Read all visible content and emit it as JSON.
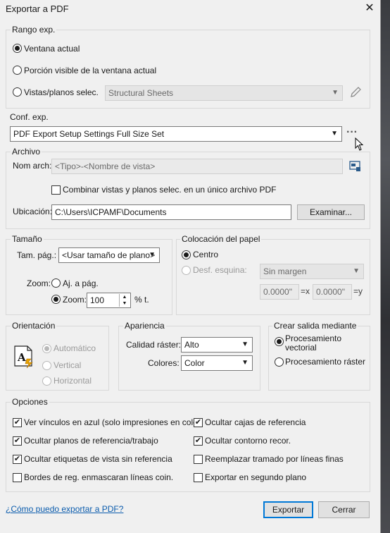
{
  "dialog": {
    "title": "Exportar a PDF",
    "close_label": "✕"
  },
  "rango": {
    "label": "Rango exp.",
    "current_window": "Ventana actual",
    "visible_portion": "Porción visible de la ventana actual",
    "views_sheets": "Vistas/planos selec.",
    "views_sheets_combo": "Structural Sheets",
    "selected": "current_window"
  },
  "conf": {
    "label": "Conf. exp.",
    "setup_combo": "PDF Export Setup Settings Full Size Set",
    "more_label": "···"
  },
  "archivo": {
    "label": "Archivo",
    "name_label": "Nom arch:",
    "name_value": "<Tipo>-<Nombre de vista>",
    "combine_label": "Combinar vistas y planos selec. en un único archivo PDF",
    "location_label": "Ubicación:",
    "location_value": "C:\\Users\\ICPAMF\\Documents",
    "browse_label": "Examinar..."
  },
  "tamano": {
    "label": "Tamaño",
    "page_label": "Tam. pág.:",
    "page_combo": "<Usar tamaño de plano>",
    "zoom_label": "Zoom:",
    "fit_label": "Aj. a pág.",
    "zoom_radio_label": "Zoom:",
    "zoom_value": "100",
    "zoom_unit": "% t.",
    "selected": "zoom"
  },
  "colocacion": {
    "label": "Colocación del papel",
    "center": "Centro",
    "offset": "Desf. esquina:",
    "margin_combo": "Sin margen",
    "x_value": "0.0000\"",
    "x_label": "=x",
    "y_value": "0.0000\"",
    "y_label": "=y",
    "selected": "center"
  },
  "orientacion": {
    "label": "Orientación",
    "automatic": "Automático",
    "vertical": "Vertical",
    "horizontal": "Horizontal",
    "selected": "automatic"
  },
  "apariencia": {
    "label": "Apariencia",
    "raster_label": "Calidad ráster:",
    "raster_value": "Alto",
    "colors_label": "Colores:",
    "colors_value": "Color"
  },
  "salida": {
    "label": "Crear salida mediante",
    "vector": "Procesamiento vectorial",
    "raster": "Procesamiento ráster",
    "selected": "vector"
  },
  "opciones": {
    "label": "Opciones",
    "items": [
      {
        "label": "Ver vínculos en azul (solo impresiones en color)",
        "checked": true
      },
      {
        "label": "Ocultar cajas de referencia",
        "checked": true
      },
      {
        "label": "Ocultar planos de referencia/trabajo",
        "checked": true
      },
      {
        "label": "Ocultar contorno recor.",
        "checked": true
      },
      {
        "label": "Ocultar etiquetas de vista sin referencia",
        "checked": true
      },
      {
        "label": "Reemplazar tramado por líneas finas",
        "checked": false
      },
      {
        "label": "Bordes de reg. enmascaran líneas coin.",
        "checked": false
      },
      {
        "label": "Exportar en segundo plano",
        "checked": false
      }
    ]
  },
  "footer": {
    "help_link": "¿Cómo puedo exportar a PDF?",
    "export_label": "Exportar",
    "cancel_label": "Cerrar"
  }
}
